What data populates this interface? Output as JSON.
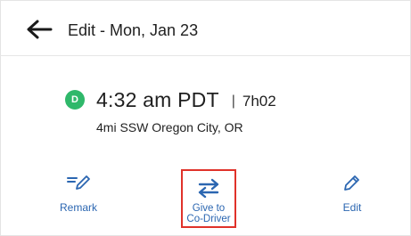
{
  "header": {
    "title": "Edit - Mon, Jan 23"
  },
  "event": {
    "status_letter": "D",
    "status_color": "#2fb86a",
    "time": "4:32 am PDT",
    "separator": "|",
    "duration": "7h02",
    "location": "4mi SSW Oregon City, OR"
  },
  "actions": {
    "remark_label": "Remark",
    "give_label_line1": "Give to",
    "give_label_line2": "Co-Driver",
    "edit_label": "Edit"
  },
  "colors": {
    "accent": "#2b66b1",
    "highlight": "#e0322a"
  }
}
